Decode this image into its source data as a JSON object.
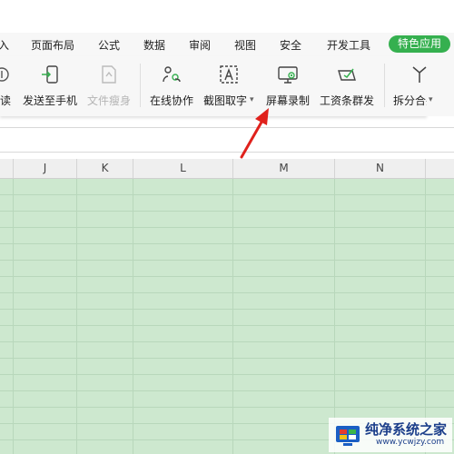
{
  "menu": {
    "items": [
      "入",
      "页面布局",
      "公式",
      "数据",
      "审阅",
      "视图",
      "安全",
      "开发工具"
    ],
    "special": "特色应用"
  },
  "toolbar": {
    "items": [
      {
        "label": "朗读",
        "icon": "read-aloud-icon"
      },
      {
        "label": "发送至手机",
        "icon": "send-to-phone-icon"
      },
      {
        "label": "文件瘦身",
        "icon": "file-slim-icon",
        "disabled": true
      },
      {
        "label": "在线协作",
        "icon": "online-collab-icon"
      },
      {
        "label": "截图取字",
        "icon": "screenshot-ocr-icon",
        "dropdown": "▾"
      },
      {
        "label": "屏幕录制",
        "icon": "screen-record-icon"
      },
      {
        "label": "工资条群发",
        "icon": "payslip-send-icon"
      },
      {
        "label": "拆分合并",
        "icon": "split-merge-icon",
        "dropdown": "▾"
      }
    ]
  },
  "columns": [
    "",
    "J",
    "K",
    "L",
    "M",
    "N",
    ""
  ],
  "watermark": {
    "title": "纯净系统之家",
    "url": "www.ycwjzy.com"
  },
  "colors": {
    "accent": "#35b04f",
    "grid_fill": "#cde8cf",
    "arrow": "#e0211c"
  }
}
